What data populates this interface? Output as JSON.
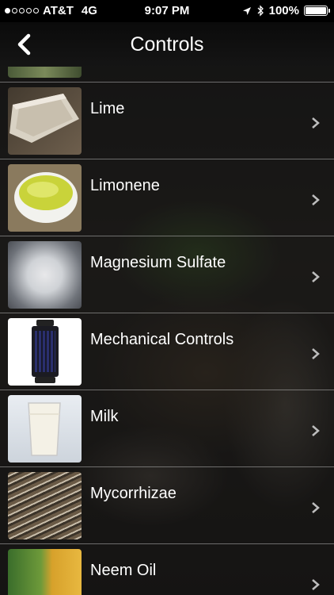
{
  "status": {
    "carrier": "AT&T",
    "network": "4G",
    "time": "9:07 PM",
    "battery": "100%",
    "signal_bars_filled": 1,
    "signal_bars_total": 5
  },
  "nav": {
    "title": "Controls",
    "back_icon": "chevron-left-icon"
  },
  "items": [
    {
      "label": "Lime"
    },
    {
      "label": "Limonene"
    },
    {
      "label": "Magnesium Sulfate"
    },
    {
      "label": "Mechanical Controls"
    },
    {
      "label": "Milk"
    },
    {
      "label": "Mycorrhizae"
    },
    {
      "label": "Neem Oil"
    }
  ],
  "colors": {
    "bar_background": "#000000",
    "text": "#ffffff",
    "separator": "#b4b4b4"
  }
}
